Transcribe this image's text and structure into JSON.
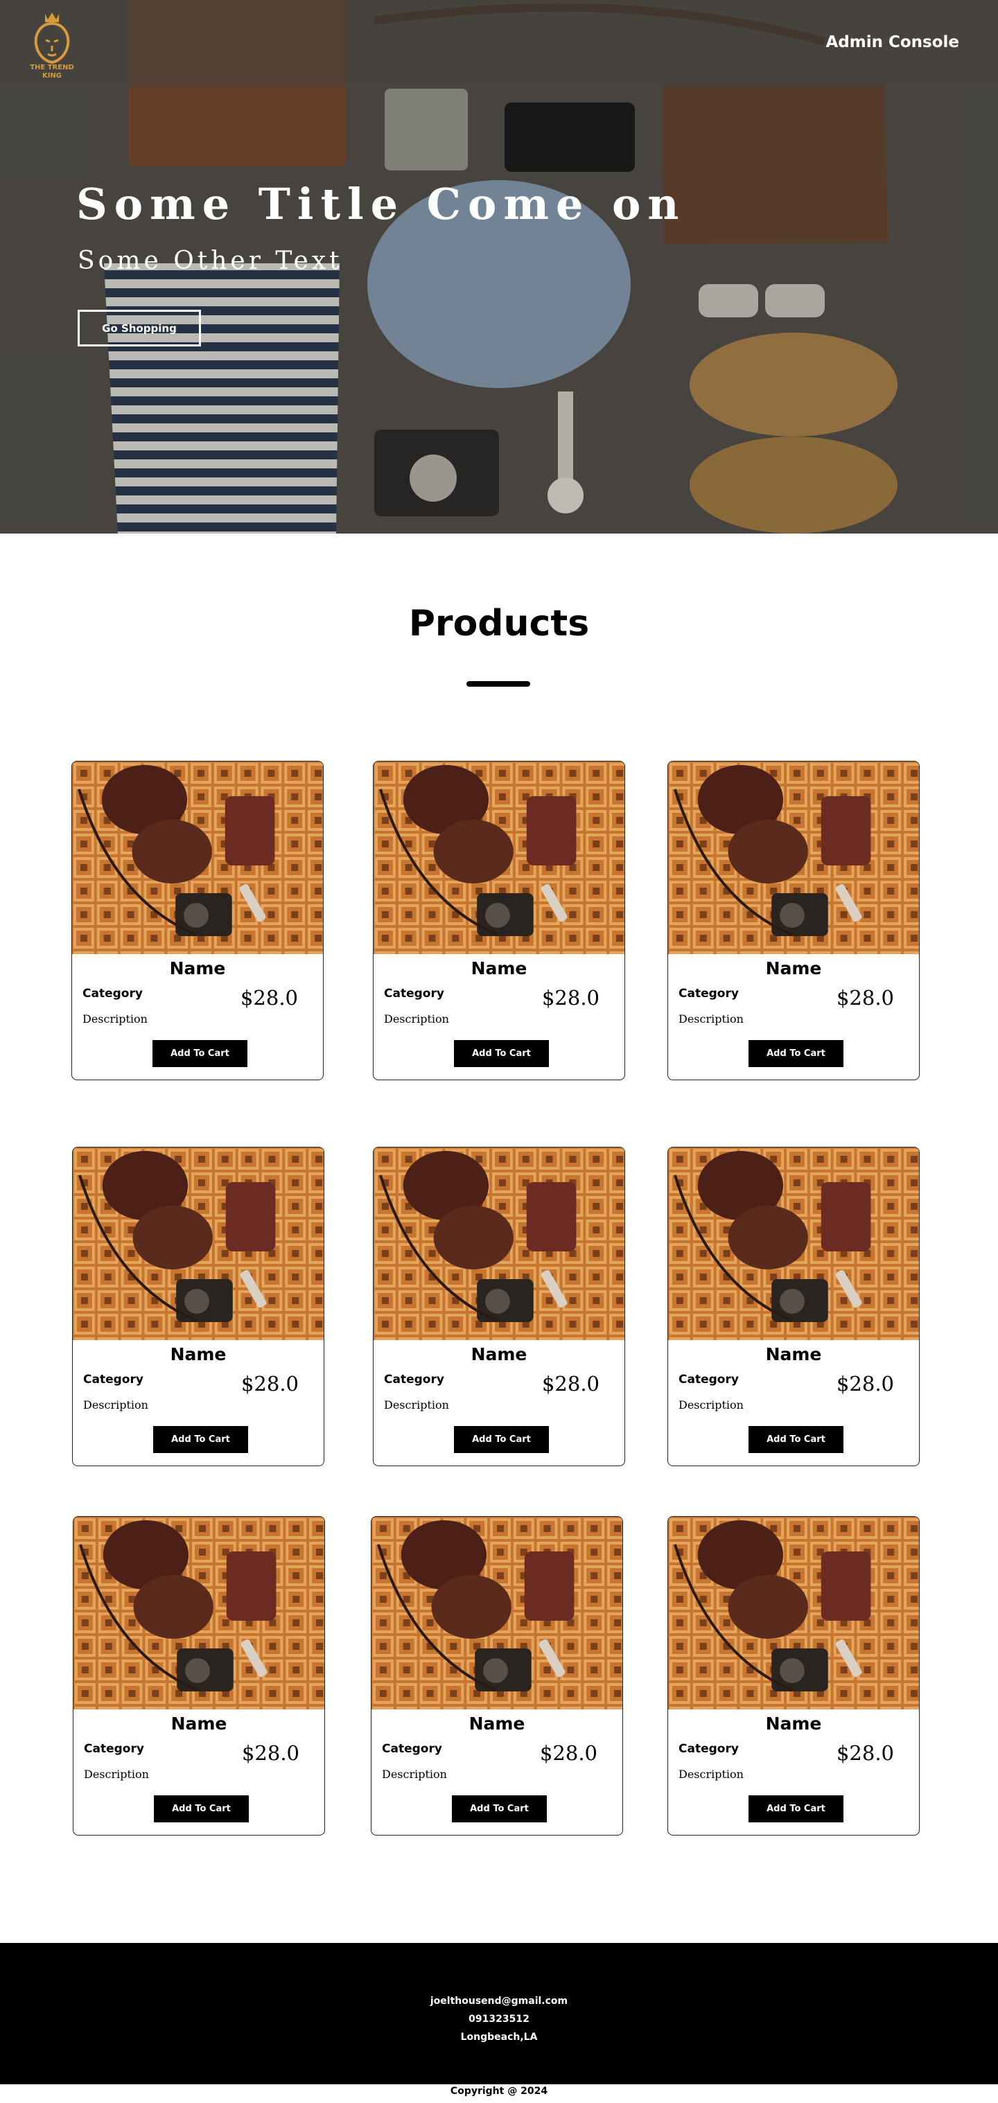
{
  "colors": {
    "accent": "#000000",
    "logo_gold": "#d79a3f",
    "hero_text": "#ffffff"
  },
  "nav": {
    "logo_line1": "THE TREND",
    "logo_line2": "KING",
    "admin_label": "Admin Console"
  },
  "hero": {
    "title": "Some Title Come on",
    "subtitle": "Some Other Text",
    "button_label": "Go Shopping"
  },
  "products": {
    "heading": "Products",
    "items": [
      {
        "name": "Name",
        "category": "Category",
        "price": "$28.0",
        "description": "Description",
        "button": "Add To Cart"
      },
      {
        "name": "Name",
        "category": "Category",
        "price": "$28.0",
        "description": "Description",
        "button": "Add To Cart"
      },
      {
        "name": "Name",
        "category": "Category",
        "price": "$28.0",
        "description": "Description",
        "button": "Add To Cart"
      },
      {
        "name": "Name",
        "category": "Category",
        "price": "$28.0",
        "description": "Description",
        "button": "Add To Cart"
      },
      {
        "name": "Name",
        "category": "Category",
        "price": "$28.0",
        "description": "Description",
        "button": "Add To Cart"
      },
      {
        "name": "Name",
        "category": "Category",
        "price": "$28.0",
        "description": "Description",
        "button": "Add To Cart"
      },
      {
        "name": "Name",
        "category": "Category",
        "price": "$28.0",
        "description": "Description",
        "button": "Add To Cart"
      },
      {
        "name": "Name",
        "category": "Category",
        "price": "$28.0",
        "description": "Description",
        "button": "Add To Cart"
      },
      {
        "name": "Name",
        "category": "Category",
        "price": "$28.0",
        "description": "Description",
        "button": "Add To Cart"
      }
    ]
  },
  "footer": {
    "email": "joelthousend@gmail.com",
    "phone": "091323512",
    "location": "Longbeach,LA",
    "copyright": "Copyright @ 2024"
  }
}
